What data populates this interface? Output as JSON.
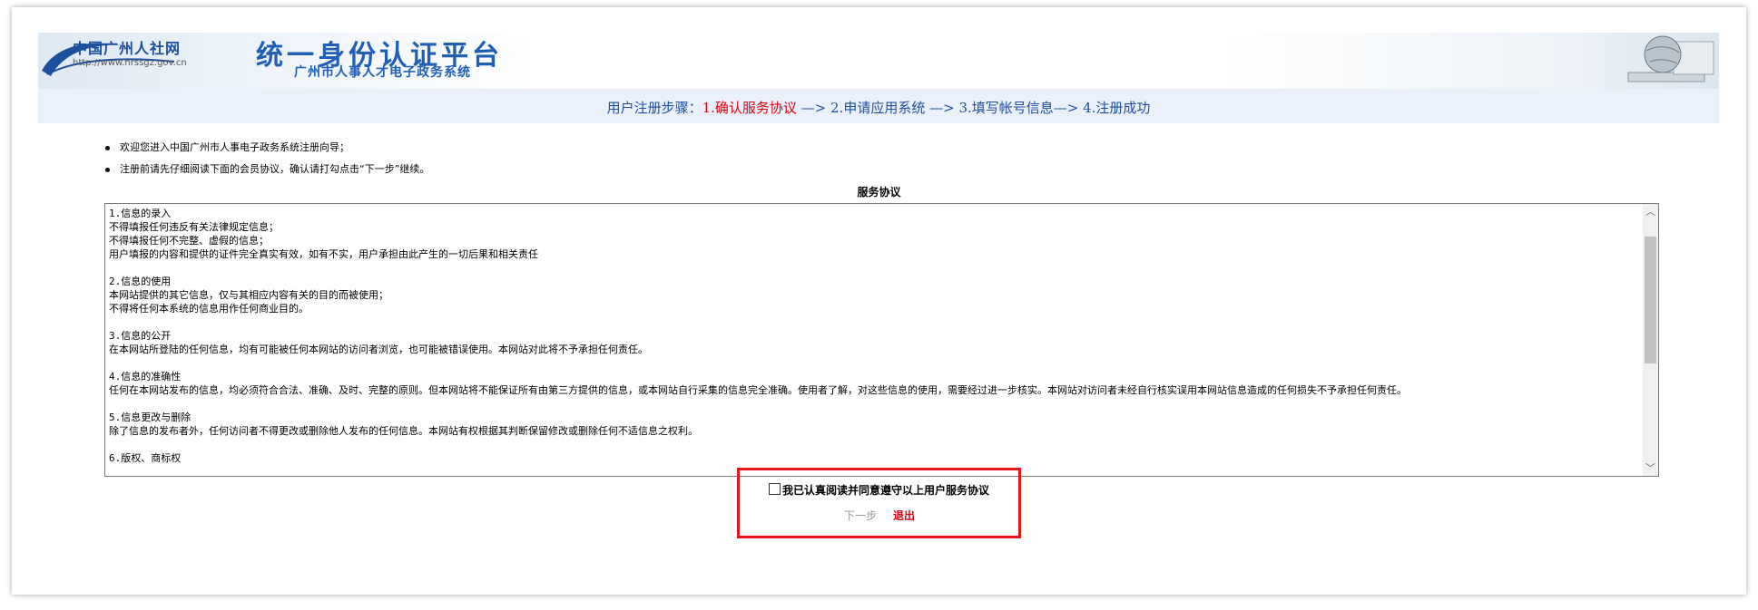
{
  "header": {
    "logo_text": "中国广州人社网",
    "logo_url": "http://www.hrssgz.gov.cn",
    "title": "统一身份认证平台",
    "subtitle": "广州市人事人才电子政务系统"
  },
  "steps": {
    "prefix": "用户注册步骤：",
    "step1": "1.确认服务协议",
    "arrow1": " —> ",
    "step2": "2.申请应用系统",
    "arrow2": " —> ",
    "step3": "3.填写帐号信息",
    "arrow3": "—> ",
    "step4": "4.注册成功"
  },
  "intro": [
    "欢迎您进入中国广州市人事电子政务系统注册向导；",
    "注册前请先仔细阅读下面的会员协议，确认请打勾点击“下一步”继续。"
  ],
  "agreement": {
    "title": "服务协议",
    "text": "1.信息的录入\n不得填报任何违反有关法律规定信息；\n不得填报任何不完整、虚假的信息；\n用户填报的内容和提供的证件完全真实有效，如有不实，用户承担由此产生的一切后果和相关责任\n\n2.信息的使用\n本网站提供的其它信息，仅与其相应内容有关的目的而被使用；\n不得将任何本系统的信息用作任何商业目的。\n\n3.信息的公开\n在本网站所登陆的任何信息，均有可能被任何本网站的访问者浏览，也可能被错误使用。本网站对此将不予承担任何责任。\n\n4.信息的准确性\n任何在本网站发布的信息，均必须符合合法、准确、及时、完整的原则。但本网站将不能保证所有由第三方提供的信息，或本网站自行采集的信息完全准确。使用者了解，对这些信息的使用，需要经过进一步核实。本网站对访问者未经自行核实误用本网站信息造成的任何损失不予承担任何责任。\n\n5.信息更改与删除\n除了信息的发布者外，任何访问者不得更改或删除他人发布的任何信息。本网站有权根据其判断保留修改或删除任何不适信息之权利。\n\n6.版权、商标权"
  },
  "consent": {
    "label": "我已认真阅读并同意遵守以上用户服务协议",
    "next_label": "下一步",
    "exit_label": "退出"
  },
  "colors": {
    "accent_blue": "#1f5fb5",
    "active_step_red": "#e60012",
    "highlight_box": "#e8141b"
  }
}
